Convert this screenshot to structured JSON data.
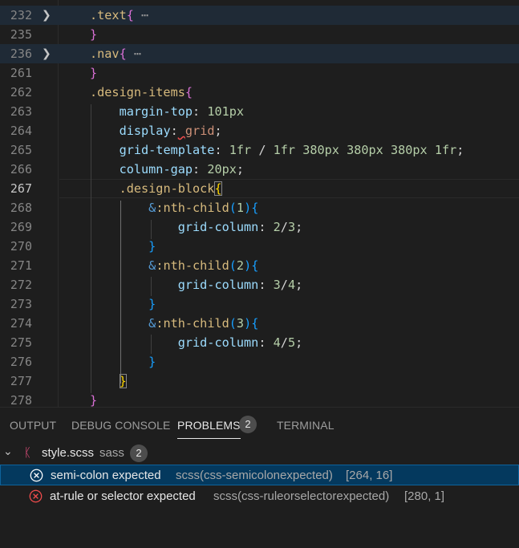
{
  "editor": {
    "lines": [
      {
        "num": "232",
        "folded": true,
        "tokens": [
          {
            "t": ".text",
            "c": "tk-sel"
          },
          {
            "t": "{",
            "c": "tk-br1"
          },
          {
            "t": " ⋯",
            "c": "tk-dots"
          }
        ]
      },
      {
        "num": "235",
        "tokens": [
          {
            "t": "}",
            "c": "tk-br1"
          }
        ]
      },
      {
        "num": "236",
        "folded": true,
        "tokens": [
          {
            "t": ".nav",
            "c": "tk-sel"
          },
          {
            "t": "{",
            "c": "tk-br1"
          },
          {
            "t": " ⋯",
            "c": "tk-dots"
          }
        ]
      },
      {
        "num": "261",
        "tokens": [
          {
            "t": "}",
            "c": "tk-br1"
          }
        ]
      },
      {
        "num": "262",
        "tokens": [
          {
            "t": ".design-items",
            "c": "tk-sel"
          },
          {
            "t": "{",
            "c": "tk-br1"
          }
        ]
      },
      {
        "num": "263",
        "tokens": [
          {
            "t": "    "
          },
          {
            "t": "margin-top",
            "c": "tk-prop"
          },
          {
            "t": ": ",
            "c": "tk-pun"
          },
          {
            "t": "101px",
            "c": "tk-num"
          }
        ]
      },
      {
        "num": "264",
        "tokens": [
          {
            "t": "    "
          },
          {
            "t": "display",
            "c": "tk-prop"
          },
          {
            "t": ":",
            "c": "tk-pun"
          },
          {
            "t": " ",
            "c": "squiggle"
          },
          {
            "t": "grid",
            "c": "tk-val"
          },
          {
            "t": ";",
            "c": "tk-pun"
          }
        ]
      },
      {
        "num": "265",
        "tokens": [
          {
            "t": "    "
          },
          {
            "t": "grid-template",
            "c": "tk-prop"
          },
          {
            "t": ": ",
            "c": "tk-pun"
          },
          {
            "t": "1fr",
            "c": "tk-num"
          },
          {
            "t": " / ",
            "c": "tk-pun"
          },
          {
            "t": "1fr",
            "c": "tk-num"
          },
          {
            "t": " ",
            "c": "tk-pun"
          },
          {
            "t": "380px",
            "c": "tk-num"
          },
          {
            "t": " ",
            "c": "tk-pun"
          },
          {
            "t": "380px",
            "c": "tk-num"
          },
          {
            "t": " ",
            "c": "tk-pun"
          },
          {
            "t": "380px",
            "c": "tk-num"
          },
          {
            "t": " ",
            "c": "tk-pun"
          },
          {
            "t": "1fr",
            "c": "tk-num"
          },
          {
            "t": ";",
            "c": "tk-pun"
          }
        ]
      },
      {
        "num": "266",
        "tokens": [
          {
            "t": "    "
          },
          {
            "t": "column-gap",
            "c": "tk-prop"
          },
          {
            "t": ": ",
            "c": "tk-pun"
          },
          {
            "t": "20px",
            "c": "tk-num"
          },
          {
            "t": ";",
            "c": "tk-pun"
          }
        ]
      },
      {
        "num": "267",
        "active": true,
        "tokens": [
          {
            "t": "    "
          },
          {
            "t": ".design-block",
            "c": "tk-sel"
          },
          {
            "t": "{",
            "c": "tk-br2 br-match"
          }
        ]
      },
      {
        "num": "268",
        "tokens": [
          {
            "t": "        "
          },
          {
            "t": "&",
            "c": "tk-amp"
          },
          {
            "t": ":nth-child",
            "c": "tk-sel"
          },
          {
            "t": "(",
            "c": "tk-br3"
          },
          {
            "t": "1",
            "c": "tk-num"
          },
          {
            "t": ")",
            "c": "tk-br3"
          },
          {
            "t": "{",
            "c": "tk-br3"
          }
        ]
      },
      {
        "num": "269",
        "tokens": [
          {
            "t": "            "
          },
          {
            "t": "grid-column",
            "c": "tk-prop"
          },
          {
            "t": ": ",
            "c": "tk-pun"
          },
          {
            "t": "2",
            "c": "tk-num"
          },
          {
            "t": "/",
            "c": "tk-pun"
          },
          {
            "t": "3",
            "c": "tk-num"
          },
          {
            "t": ";",
            "c": "tk-pun"
          }
        ]
      },
      {
        "num": "270",
        "tokens": [
          {
            "t": "        "
          },
          {
            "t": "}",
            "c": "tk-br3"
          }
        ]
      },
      {
        "num": "271",
        "tokens": [
          {
            "t": "        "
          },
          {
            "t": "&",
            "c": "tk-amp"
          },
          {
            "t": ":nth-child",
            "c": "tk-sel"
          },
          {
            "t": "(",
            "c": "tk-br3"
          },
          {
            "t": "2",
            "c": "tk-num"
          },
          {
            "t": ")",
            "c": "tk-br3"
          },
          {
            "t": "{",
            "c": "tk-br3"
          }
        ]
      },
      {
        "num": "272",
        "tokens": [
          {
            "t": "            "
          },
          {
            "t": "grid-column",
            "c": "tk-prop"
          },
          {
            "t": ": ",
            "c": "tk-pun"
          },
          {
            "t": "3",
            "c": "tk-num"
          },
          {
            "t": "/",
            "c": "tk-pun"
          },
          {
            "t": "4",
            "c": "tk-num"
          },
          {
            "t": ";",
            "c": "tk-pun"
          }
        ]
      },
      {
        "num": "273",
        "tokens": [
          {
            "t": "        "
          },
          {
            "t": "}",
            "c": "tk-br3"
          }
        ]
      },
      {
        "num": "274",
        "tokens": [
          {
            "t": "        "
          },
          {
            "t": "&",
            "c": "tk-amp"
          },
          {
            "t": ":nth-child",
            "c": "tk-sel"
          },
          {
            "t": "(",
            "c": "tk-br3"
          },
          {
            "t": "3",
            "c": "tk-num"
          },
          {
            "t": ")",
            "c": "tk-br3"
          },
          {
            "t": "{",
            "c": "tk-br3"
          }
        ]
      },
      {
        "num": "275",
        "tokens": [
          {
            "t": "            "
          },
          {
            "t": "grid-column",
            "c": "tk-prop"
          },
          {
            "t": ": ",
            "c": "tk-pun"
          },
          {
            "t": "4",
            "c": "tk-num"
          },
          {
            "t": "/",
            "c": "tk-pun"
          },
          {
            "t": "5",
            "c": "tk-num"
          },
          {
            "t": ";",
            "c": "tk-pun"
          }
        ]
      },
      {
        "num": "276",
        "tokens": [
          {
            "t": "        "
          },
          {
            "t": "}",
            "c": "tk-br3"
          }
        ]
      },
      {
        "num": "277",
        "tokens": [
          {
            "t": "    "
          },
          {
            "t": "}",
            "c": "tk-br2 br-match"
          }
        ]
      },
      {
        "num": "278",
        "tokens": [
          {
            "t": "}",
            "c": "tk-br1"
          }
        ]
      }
    ]
  },
  "panel": {
    "tabs": [
      {
        "label": "OUTPUT"
      },
      {
        "label": "DEBUG CONSOLE"
      },
      {
        "label": "PROBLEMS",
        "active": true,
        "badge": "2"
      },
      {
        "label": "TERMINAL"
      }
    ],
    "file": {
      "name": "style.scss",
      "lang": "sass",
      "count": "2",
      "icon": "sass-file-icon"
    },
    "problems": [
      {
        "message": "semi-colon expected",
        "source": "scss(css-semicolonexpected)",
        "location": "[264, 16]",
        "selected": true
      },
      {
        "message": "at-rule or selector expected",
        "source": "scss(css-ruleorselectorexpected)",
        "location": "[280, 1]",
        "selected": false
      }
    ]
  },
  "colors": {
    "accent": "#0e639c",
    "error": "#f14c4c",
    "selection": "#04395e"
  }
}
